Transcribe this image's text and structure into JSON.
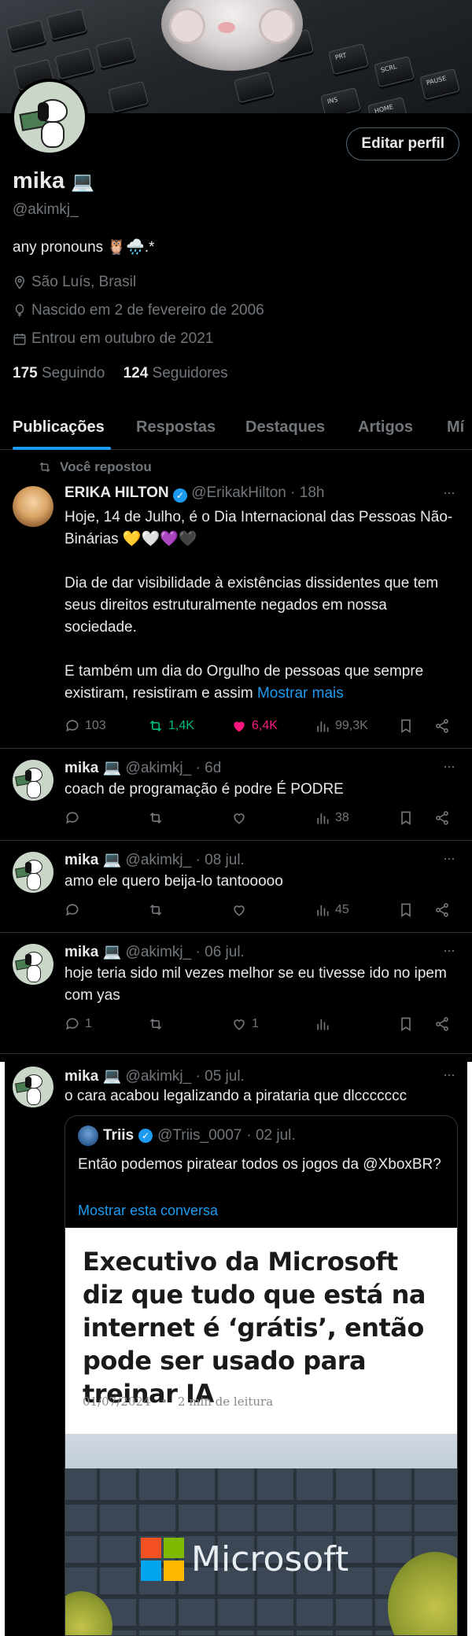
{
  "profile": {
    "edit_button": "Editar perfil",
    "name": "mika",
    "name_emoji": "💻",
    "handle": "@akimkj_",
    "bio": "any pronouns 🦉🌧️.*",
    "location": "São Luís, Brasil",
    "born": "Nascido em 2 de fevereiro de 2006",
    "joined": "Entrou em outubro de 2021",
    "following_count": "175",
    "following_label": "Seguindo",
    "followers_count": "124",
    "followers_label": "Seguidores"
  },
  "tabs": [
    {
      "label": "Publicações",
      "active": true
    },
    {
      "label": "Respostas"
    },
    {
      "label": "Destaques"
    },
    {
      "label": "Artigos"
    },
    {
      "label": "Mí"
    }
  ],
  "repost_note": "Você repostou",
  "posts": [
    {
      "author": "ERIKA HILTON",
      "handle": "@ErikakHilton",
      "time": "· 18h",
      "text": "Hoje, 14 de Julho, é o Dia Internacional das Pessoas Não-Binárias 💛🤍💜🖤\n\nDia de dar visibilidade à existências dissidentes que tem seus direitos estruturalmente negados em nossa sociedade.\n\nE também um dia do Orgulho de pessoas que sempre existiram, resistiram e assim",
      "show_more": "Mostrar mais",
      "replies": "103",
      "reposts": "1,4K",
      "likes": "6,4K",
      "views": "99,3K"
    },
    {
      "author": "mika 💻",
      "handle": "@akimkj_",
      "time": "· 6d",
      "text": "coach de programação é podre É PODRE",
      "replies": "",
      "reposts": "",
      "likes": "",
      "views": "38"
    },
    {
      "author": "mika 💻",
      "handle": "@akimkj_",
      "time": "· 08 jul.",
      "text": "amo ele quero beija-lo tantooooo",
      "replies": "",
      "reposts": "",
      "likes": "",
      "views": "45"
    },
    {
      "author": "mika 💻",
      "handle": "@akimkj_",
      "time": "· 06 jul.",
      "text": "hoje teria sido mil vezes melhor se eu tivesse ido no ipem com yas",
      "replies": "1",
      "reposts": "",
      "likes": "1",
      "views": ""
    },
    {
      "author": "mika 💻",
      "handle": "@akimkj_",
      "time": "· 05 jul.",
      "text": "o cara acabou legalizando a pirataria que dlccccccc"
    }
  ],
  "quote": {
    "author": "Triis",
    "handle": "@Triis_0007",
    "time": "· 02 jul.",
    "text": "Então podemos piratear todos os jogos da @XboxBR?",
    "show_conversation": "Mostrar esta conversa",
    "article_title": "Executivo da Microsoft diz que tudo que está na internet é ‘grátis’, então pode ser usado para treinar IA",
    "article_date": "01/07/2024",
    "article_read": "2 min de leitura",
    "logo_word": "Microsoft"
  },
  "colors": {
    "accent": "#1d9bf0",
    "repost_green": "#00ba7c",
    "like_pink": "#f91880",
    "muted": "#71767b"
  }
}
